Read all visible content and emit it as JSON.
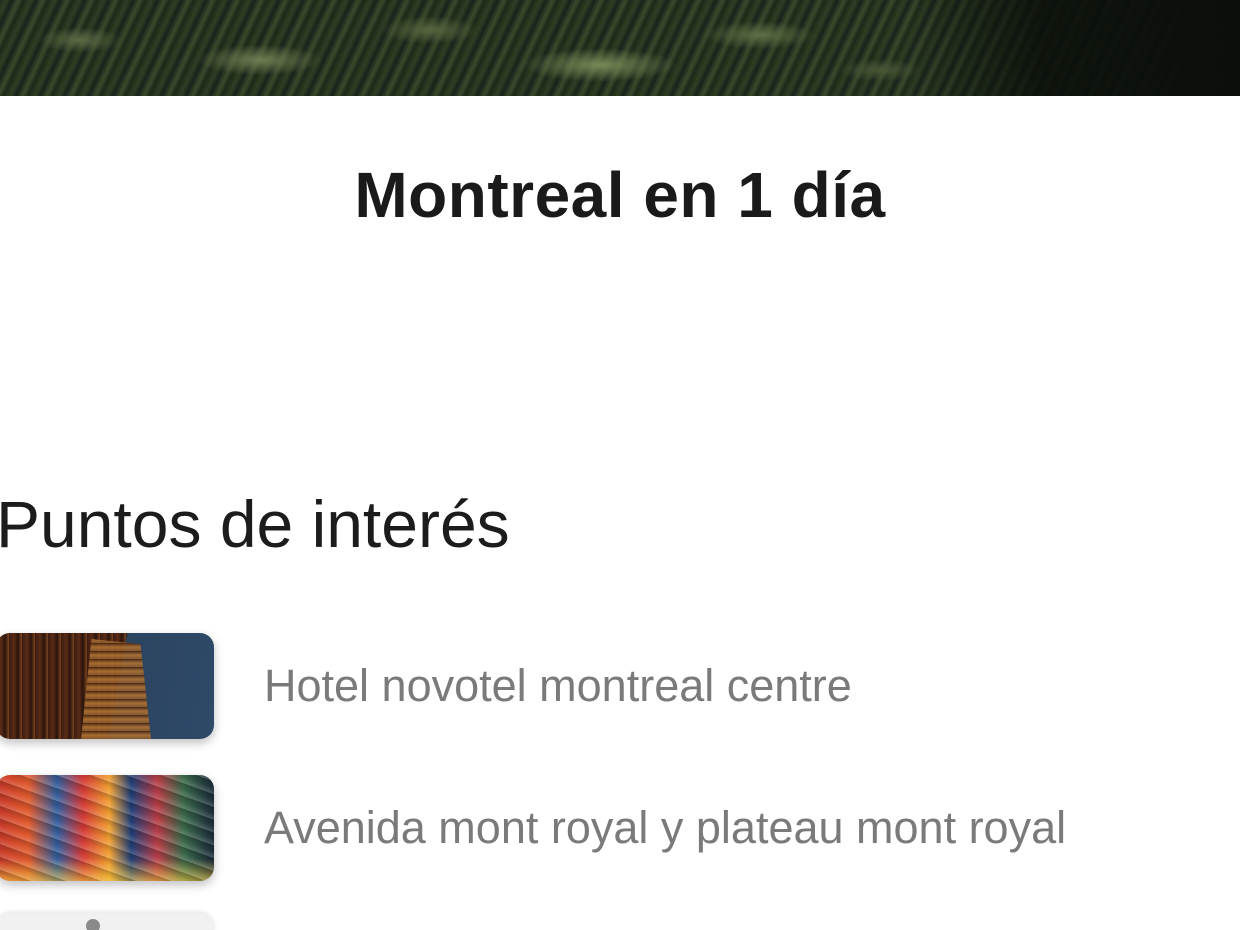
{
  "header": {
    "title": "Montreal en 1 día"
  },
  "points_of_interest": {
    "heading": "Puntos de interés",
    "items": [
      {
        "label": "Hotel novotel montreal centre",
        "thumbnail": "hotel-photo"
      },
      {
        "label": "Avenida mont royal y plateau mont royal",
        "thumbnail": "graffiti-street-photo"
      }
    ]
  }
}
